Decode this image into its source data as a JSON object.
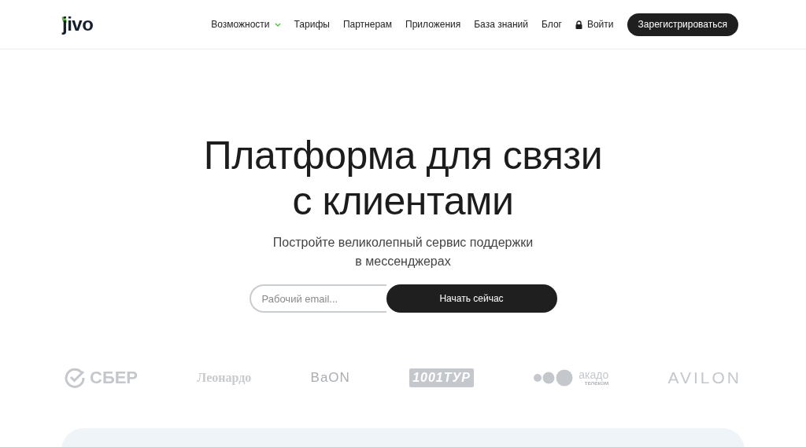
{
  "logo": {
    "text": "jivo"
  },
  "nav": [
    {
      "label": "Возможности",
      "kind": "dropdown"
    },
    {
      "label": "Тарифы",
      "kind": "link"
    },
    {
      "label": "Партнерам",
      "kind": "link"
    },
    {
      "label": "Приложения",
      "kind": "link"
    },
    {
      "label": "База знаний",
      "kind": "link"
    },
    {
      "label": "Блог",
      "kind": "link"
    },
    {
      "label": "Войти",
      "kind": "login"
    }
  ],
  "signup_button": "Зарегистрироваться",
  "hero": {
    "title_lines": [
      "Платформа для связи",
      "с клиентами"
    ],
    "subtitle_lines": [
      "Постройте великолепный сервис поддержки",
      "в мессенджерах"
    ]
  },
  "form": {
    "placeholder": "Рабочий email...",
    "button": "Начать сейчас"
  },
  "clients": [
    {
      "kind": "check",
      "text": "СБЕР"
    },
    {
      "kind": "serif",
      "text": "Леонардо"
    },
    {
      "kind": "thin",
      "text": "BaON"
    },
    {
      "kind": "boxed",
      "text": "1001ТУР"
    },
    {
      "kind": "dots",
      "text": "акадо",
      "subtext": "телеком"
    },
    {
      "kind": "wide",
      "text": "AVILON"
    }
  ]
}
